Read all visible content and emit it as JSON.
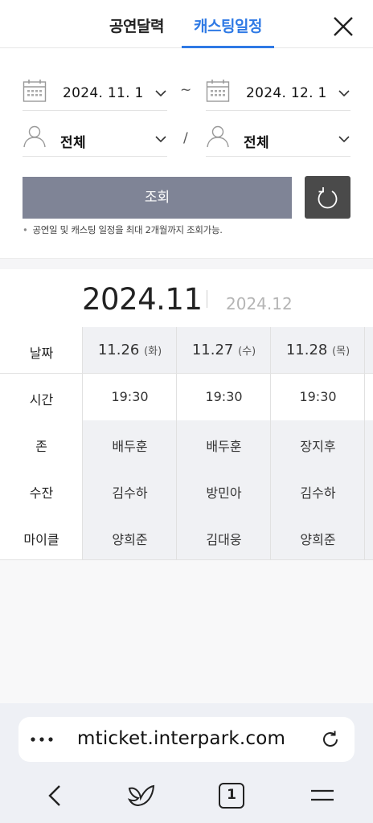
{
  "header": {
    "tab_calendar": "공연달력",
    "tab_casting": "캐스팅일정"
  },
  "filter": {
    "date_from": "2024. 11. 1",
    "date_separator": "~",
    "date_to": "2024. 12. 1",
    "actor_filter_1": "전체",
    "filter_separator": "/",
    "actor_filter_2": "전체",
    "search_label": "조회",
    "note": "공연일 및 캐스팅 일정을 최대 2개월까지 조회가능."
  },
  "months": {
    "current": "2024.11",
    "next": "2024.12"
  },
  "schedule": {
    "row_labels": [
      "날짜",
      "시간",
      "존",
      "수잔",
      "마이클"
    ],
    "columns": [
      {
        "date": "11.26",
        "dow": "(화)",
        "time": "19:30",
        "john": "배두훈",
        "susan": "김수하",
        "michael": "양희준"
      },
      {
        "date": "11.27",
        "dow": "(수)",
        "time": "19:30",
        "john": "배두훈",
        "susan": "방민아",
        "michael": "김대웅"
      },
      {
        "date": "11.28",
        "dow": "(목)",
        "time": "19:30",
        "john": "장지후",
        "susan": "김수하",
        "michael": "양희준"
      }
    ]
  },
  "browser": {
    "url": "mticket.interpark.com",
    "tab_count": "1"
  },
  "colors": {
    "accent": "#2f7ae5",
    "search_button": "#7f8496",
    "reset_button": "#4a4a4a"
  }
}
